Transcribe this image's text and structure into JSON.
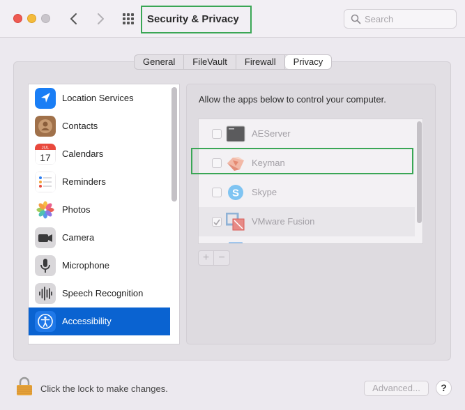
{
  "window": {
    "title": "Security & Privacy",
    "traffic_lights": [
      "close",
      "minimize",
      "zoom"
    ]
  },
  "toolbar": {
    "back_icon": "chevron-left-icon",
    "forward_icon": "chevron-right-icon",
    "show_all_icon": "grid-icon",
    "search": {
      "placeholder": "Search",
      "value": ""
    }
  },
  "tabs": [
    {
      "label": "General",
      "active": false
    },
    {
      "label": "FileVault",
      "active": false
    },
    {
      "label": "Firewall",
      "active": false
    },
    {
      "label": "Privacy",
      "active": true
    }
  ],
  "sidebar": {
    "items": [
      {
        "label": "Location Services",
        "icon": "location-arrow-icon",
        "selected": false
      },
      {
        "label": "Contacts",
        "icon": "contacts-icon",
        "selected": false
      },
      {
        "label": "Calendars",
        "icon": "calendar-icon",
        "selected": false,
        "icon_month": "JUL",
        "icon_day": "17"
      },
      {
        "label": "Reminders",
        "icon": "reminders-icon",
        "selected": false
      },
      {
        "label": "Photos",
        "icon": "photos-icon",
        "selected": false
      },
      {
        "label": "Camera",
        "icon": "camera-icon",
        "selected": false
      },
      {
        "label": "Microphone",
        "icon": "microphone-icon",
        "selected": false
      },
      {
        "label": "Speech Recognition",
        "icon": "waveform-icon",
        "selected": false
      },
      {
        "label": "Accessibility",
        "icon": "accessibility-icon",
        "selected": true
      }
    ]
  },
  "detail": {
    "caption": "Allow the apps below to control your computer.",
    "apps": [
      {
        "name": "AEServer",
        "checked": false,
        "icon": "terminal-app-icon"
      },
      {
        "name": "Keyman",
        "checked": false,
        "icon": "keyman-icon"
      },
      {
        "name": "Skype",
        "checked": false,
        "icon": "skype-icon"
      },
      {
        "name": "VMware Fusion",
        "checked": true,
        "icon": "vmware-fusion-icon"
      }
    ],
    "add_label": "+",
    "remove_label": "−"
  },
  "footer": {
    "lock_text": "Click the lock to make changes.",
    "advanced_label": "Advanced...",
    "help_label": "?"
  },
  "colors": {
    "selection": "#0a63d1",
    "highlight_box": "#3aa655",
    "close": "#ee5a52",
    "minimize": "#f4bb3b"
  }
}
